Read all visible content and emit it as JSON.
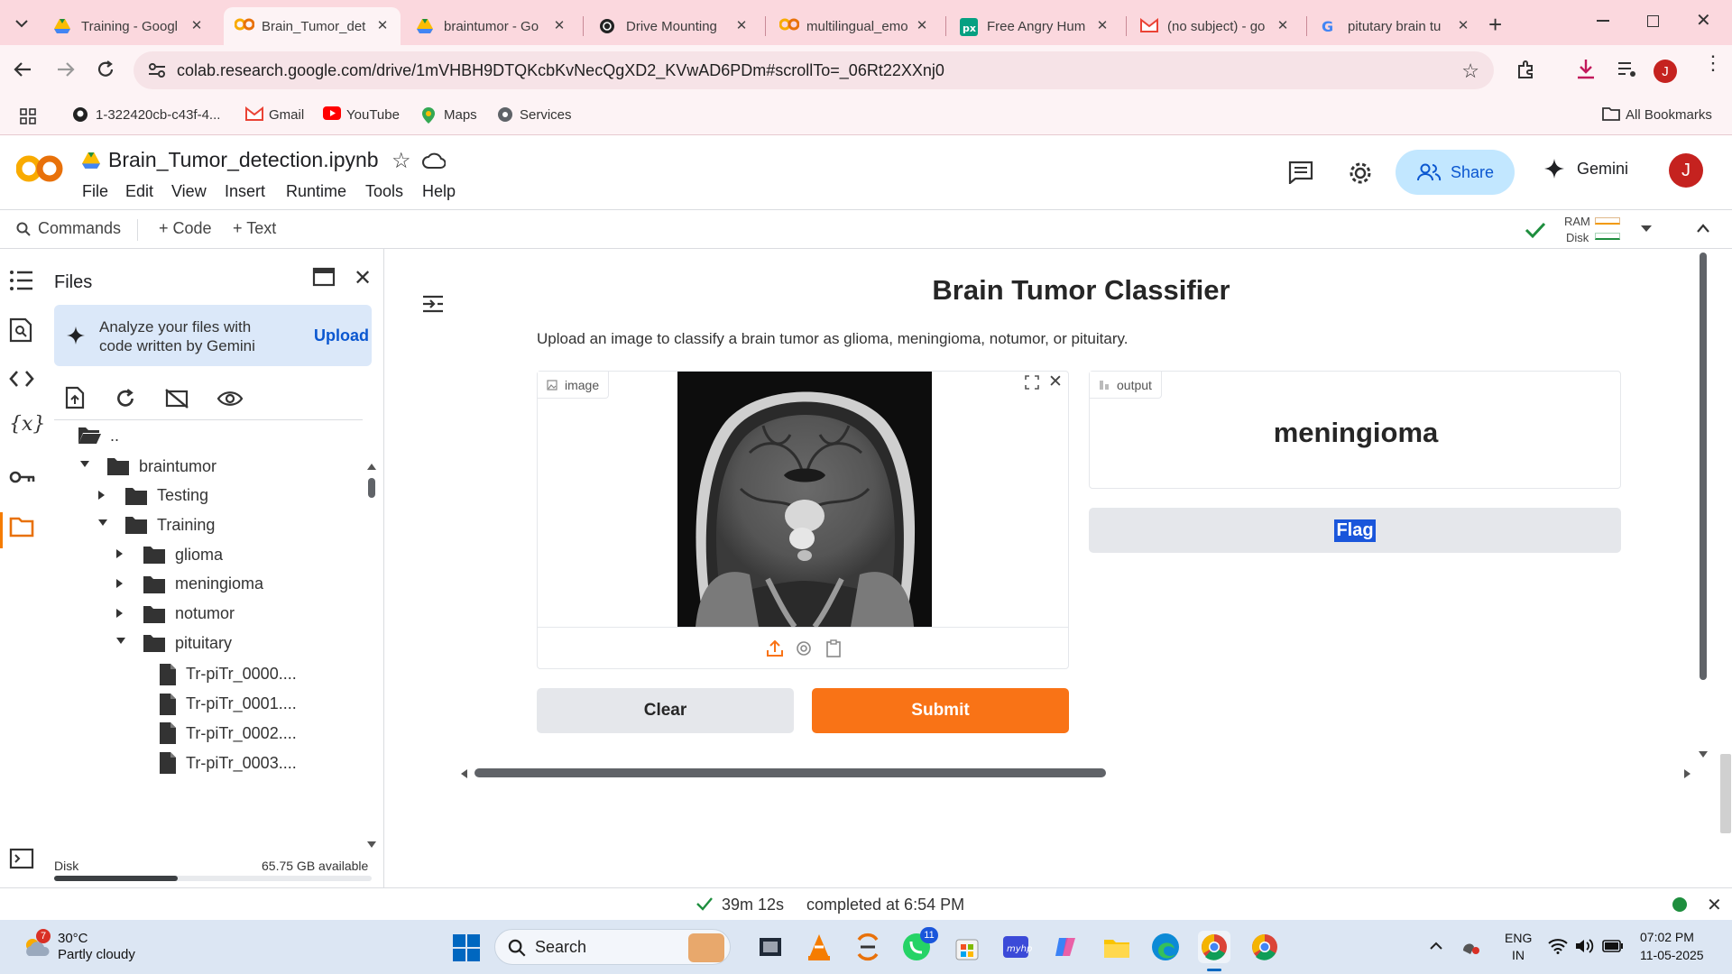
{
  "browser": {
    "tabs": [
      {
        "title": "Training - Googl",
        "favicon": "google-drive-icon"
      },
      {
        "title": "Brain_Tumor_det",
        "favicon": "colab-icon",
        "active": true
      },
      {
        "title": "braintumor - Go",
        "favicon": "google-drive-icon"
      },
      {
        "title": "Drive Mounting",
        "favicon": "chatgpt-icon"
      },
      {
        "title": "multilingual_emo",
        "favicon": "colab-icon"
      },
      {
        "title": "Free Angry Hum",
        "favicon": "pexels-icon"
      },
      {
        "title": "(no subject) - go",
        "favicon": "gmail-icon"
      },
      {
        "title": "pitutary brain tu",
        "favicon": "google-icon"
      }
    ],
    "url": "colab.research.google.com/drive/1mVHBH9DTQKcbKvNecQgXD2_KVwAD6PDm#scrollTo=_06Rt22XXnj0",
    "profile_initial": "J",
    "bookmarks": [
      {
        "label": "1-322420cb-c43f-4...",
        "icon": "github-icon"
      },
      {
        "label": "Gmail",
        "icon": "gmail-icon"
      },
      {
        "label": "YouTube",
        "icon": "youtube-icon"
      },
      {
        "label": "Maps",
        "icon": "maps-icon"
      },
      {
        "label": "Services",
        "icon": "services-icon"
      }
    ],
    "all_bookmarks": "All Bookmarks"
  },
  "colab": {
    "notebook_title": "Brain_Tumor_detection.ipynb",
    "menu": [
      "File",
      "Edit",
      "View",
      "Insert",
      "Runtime",
      "Tools",
      "Help"
    ],
    "share_label": "Share",
    "gemini_label": "Gemini",
    "user_initial": "J",
    "commands_label": "Commands",
    "add_code": "+ Code",
    "add_text": "+ Text",
    "ram_label": "RAM",
    "disk_label": "Disk"
  },
  "files_panel": {
    "title": "Files",
    "gemini_prompt": "Analyze your files with code written by Gemini",
    "upload_label": "Upload",
    "parent_dir": "..",
    "tree": [
      {
        "name": "braintumor",
        "type": "folder",
        "expanded": true
      },
      {
        "name": "Testing",
        "type": "folder",
        "expanded": false
      },
      {
        "name": "Training",
        "type": "folder",
        "expanded": true
      },
      {
        "name": "glioma",
        "type": "folder",
        "expanded": false
      },
      {
        "name": "meningioma",
        "type": "folder",
        "expanded": false
      },
      {
        "name": "notumor",
        "type": "folder",
        "expanded": false
      },
      {
        "name": "pituitary",
        "type": "folder",
        "expanded": true
      },
      {
        "name": "Tr-piTr_0000....",
        "type": "file"
      },
      {
        "name": "Tr-piTr_0001....",
        "type": "file"
      },
      {
        "name": "Tr-piTr_0002....",
        "type": "file"
      },
      {
        "name": "Tr-piTr_0003....",
        "type": "file"
      }
    ],
    "disk_label": "Disk",
    "disk_available": "65.75 GB available",
    "disk_used_fraction": 0.39
  },
  "app": {
    "title": "Brain Tumor Classifier",
    "description": "Upload an image to classify a brain tumor as glioma, meningioma, notumor, or pituitary.",
    "image_label": "image",
    "output_label": "output",
    "prediction": "meningioma",
    "flag_label": "Flag",
    "clear_label": "Clear",
    "submit_label": "Submit",
    "accent_color": "#f97316"
  },
  "status": {
    "elapsed": "39m 12s",
    "completed": "completed at 6:54 PM"
  },
  "taskbar": {
    "weather_temp": "30°C",
    "weather_desc": "Partly cloudy",
    "weather_badge": "7",
    "search_label": "Search",
    "whatsapp_badge": "11",
    "lang_top": "ENG",
    "lang_bottom": "IN",
    "time": "07:02 PM",
    "date": "11-05-2025"
  }
}
